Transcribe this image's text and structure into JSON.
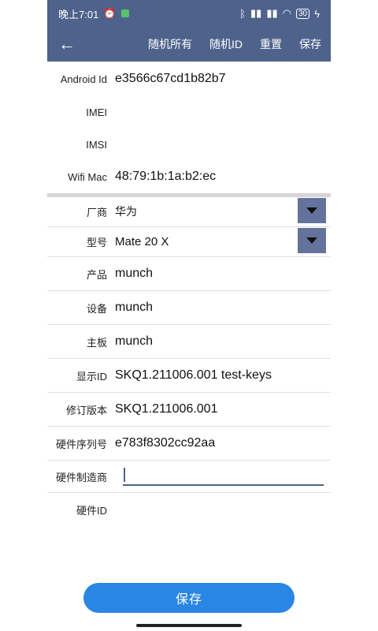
{
  "status": {
    "time": "晚上7:01",
    "battery": "30"
  },
  "toolbar": {
    "randomize_all": "随机所有",
    "random_id": "随机ID",
    "reset": "重置",
    "save": "保存"
  },
  "ids": [
    {
      "label": "Android Id",
      "value": "e3566c67cd1b82b7"
    },
    {
      "label": "IMEI",
      "value": ""
    },
    {
      "label": "IMSI",
      "value": ""
    },
    {
      "label": "Wifi Mac",
      "value": "48:79:1b:1a:b2:ec"
    }
  ],
  "device": {
    "manufacturer": {
      "label": "厂商",
      "value": "华为"
    },
    "model": {
      "label": "型号",
      "value": "Mate 20 X"
    },
    "product": {
      "label": "产品",
      "value": "munch"
    },
    "device": {
      "label": "设备",
      "value": "munch"
    },
    "board": {
      "label": "主板",
      "value": "munch"
    },
    "display_id": {
      "label": "显示ID",
      "value": "SKQ1.211006.001 test-keys"
    },
    "revision": {
      "label": "修订版本",
      "value": "SKQ1.211006.001"
    },
    "serial": {
      "label": "硬件序列号",
      "value": "e783f8302cc92aa"
    },
    "hw_manufacturer": {
      "label": "硬件制造商",
      "value": ""
    },
    "hw_id": {
      "label": "硬件ID",
      "value": ""
    }
  },
  "bottom": {
    "save_label": "保存"
  },
  "colors": {
    "toolbar": "#4e628c",
    "dropdown": "#63739b",
    "save_button": "#2a86e4"
  }
}
